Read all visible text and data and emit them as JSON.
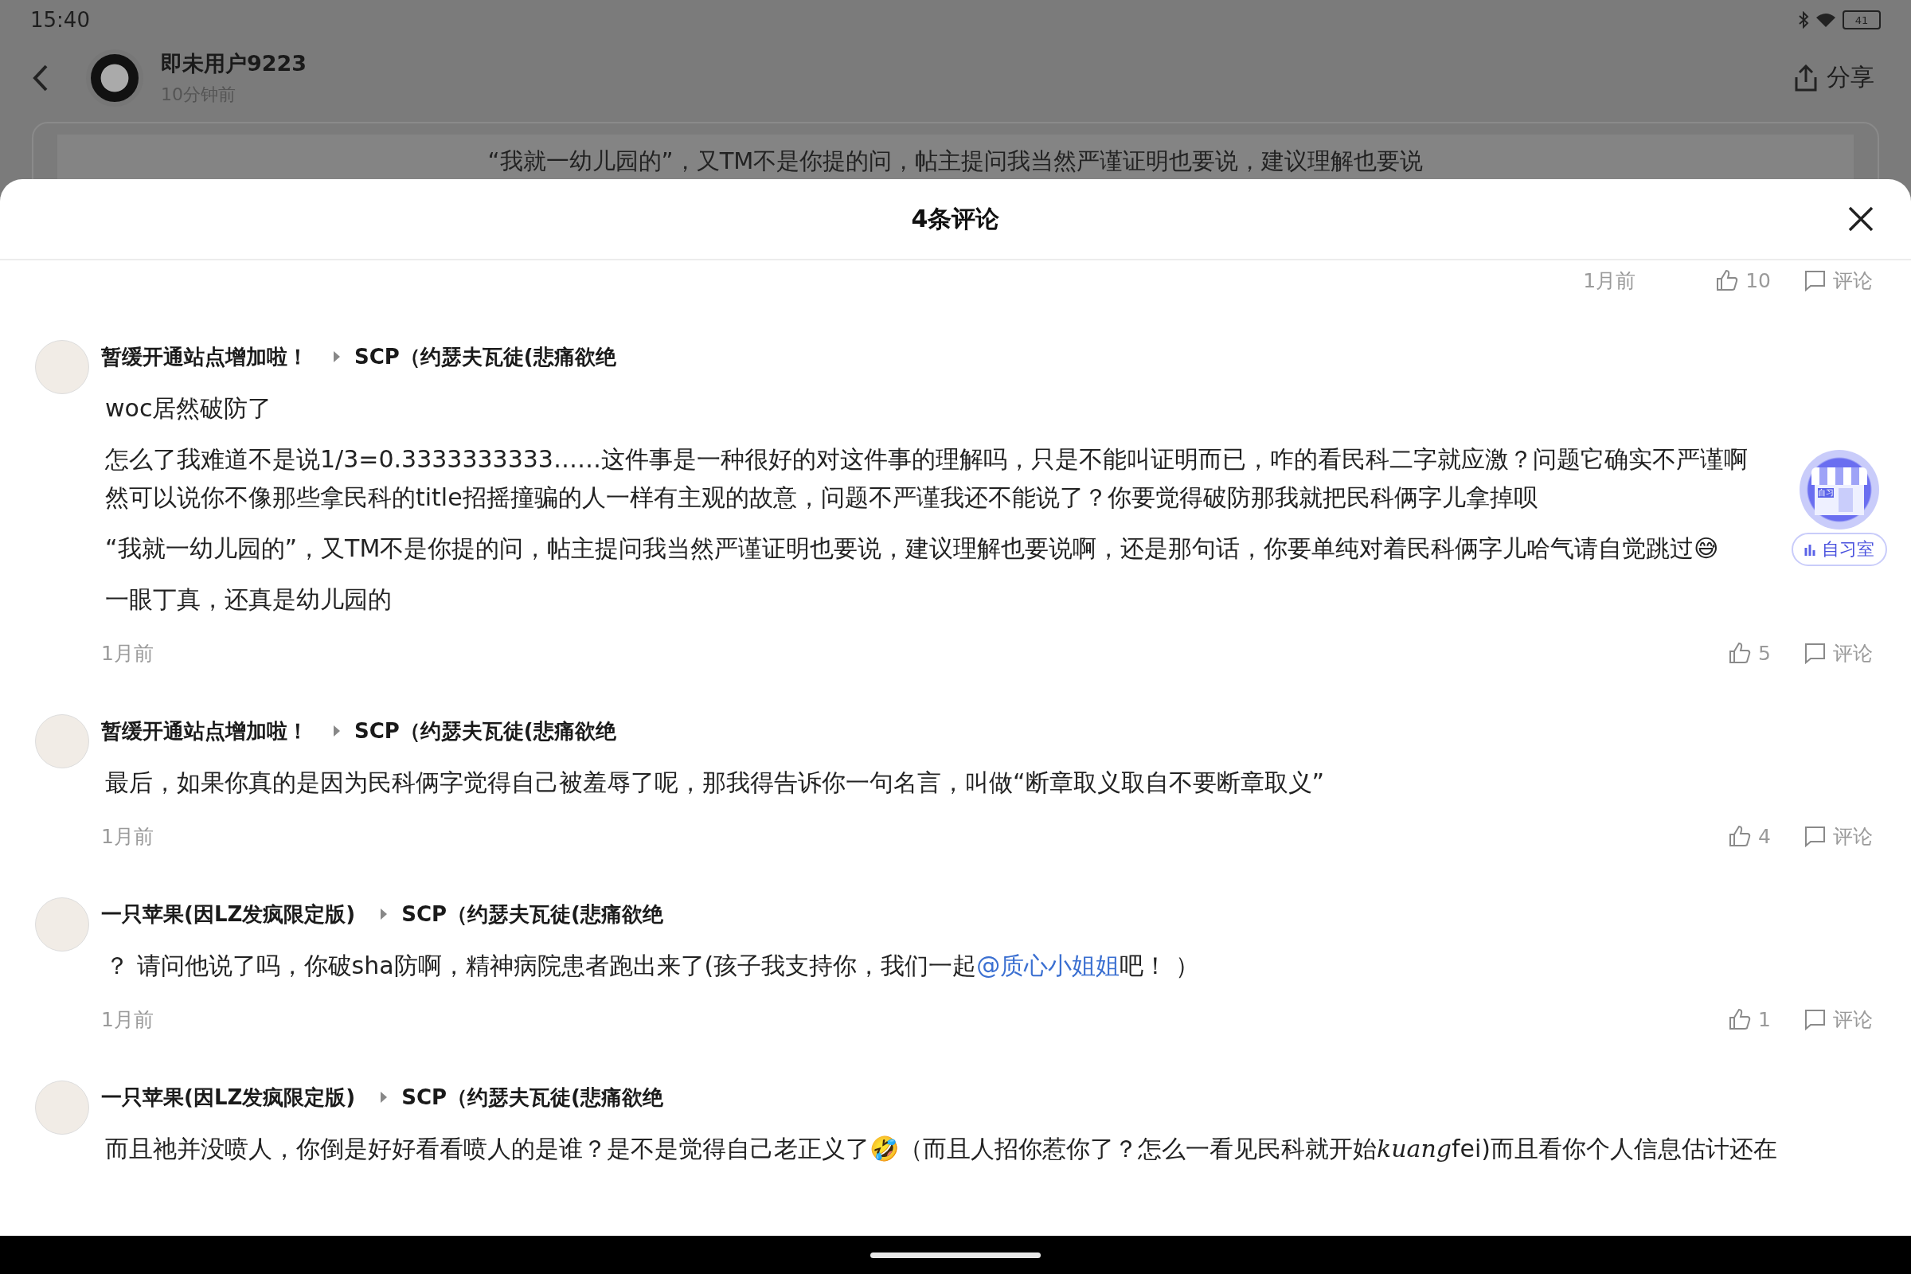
{
  "status_bar": {
    "time": "15:40",
    "battery": "41"
  },
  "post_header": {
    "user": "即未用户9223",
    "time": "10分钟前",
    "share": "分享",
    "excerpt": "“我就一幼儿园的”，又TM不是你提的问，帖主提问我当然严谨证明也要说，建议理解也要说"
  },
  "sheet": {
    "title": "4条评论"
  },
  "previous_meta": {
    "time": "1月前",
    "likes": "10",
    "reply": "评论"
  },
  "comments": [
    {
      "user": "暂缓开通站点增加啦！",
      "reply_to": "SCP（约瑟夫瓦徒(悲痛欲绝",
      "paragraphs": [
        {
          "lines": [
            "woc居然破防了"
          ]
        },
        {
          "lines": [
            "怎么了我难道不是说1/3=0.3333333333……这件事是一种很好的对这件事的理解吗，只是不能叫证明而已，咋的看民科二字就应激？问题它确实不严谨啊",
            "然可以说你不像那些拿民科的title招摇撞骗的人一样有主观的故意，问题不严谨我还不能说了？你要觉得破防那我就把民科俩字儿拿掉呗"
          ]
        },
        {
          "lines": [
            "“我就一幼儿园的”，又TM不是你提的问，帖主提问我当然严谨证明也要说，建议理解也要说啊，还是那句话，你要单纯对着民科俩字儿哈气请自觉跳过😅"
          ]
        },
        {
          "lines": [
            "一眼丁真，还真是幼儿园的"
          ]
        }
      ],
      "meta": {
        "time": "1月前",
        "likes": "5",
        "reply": "评论"
      }
    },
    {
      "user": "暂缓开通站点增加啦！",
      "reply_to": "SCP（约瑟夫瓦徒(悲痛欲绝",
      "paragraphs": [
        {
          "lines": [
            "最后，如果你真的是因为民科俩字觉得自己被羞辱了呢，那我得告诉你一句名言，叫做“断章取义取自不要断章取义”"
          ]
        }
      ],
      "meta": {
        "time": "1月前",
        "likes": "4",
        "reply": "评论"
      }
    },
    {
      "user": "一只苹果(因LZ发疯限定版)",
      "reply_to": "SCP（约瑟夫瓦徒(悲痛欲绝",
      "paragraphs": [
        {
          "segments": [
            {
              "kind": "text",
              "text": "？ 请问他说了吗，你破sha防啊，精神病院患者跑出来了(孩子我支持你，我们一起"
            },
            {
              "kind": "mention",
              "text": "@质心小姐姐"
            },
            {
              "kind": "text",
              "text": "吧！ ）"
            }
          ]
        }
      ],
      "meta": {
        "time": "1月前",
        "likes": "1",
        "reply": "评论"
      }
    },
    {
      "user": "一只苹果(因LZ发疯限定版)",
      "reply_to": "SCP（约瑟夫瓦徒(悲痛欲绝",
      "paragraphs": [
        {
          "segments": [
            {
              "kind": "text",
              "text": "而且祂并没喷人，你倒是好好看看喷人的是谁？是不是觉得自己老正义了🤣（而且人招你惹你了？怎么一看见民科就开始"
            },
            {
              "kind": "italic",
              "text": "kuang"
            },
            {
              "kind": "text",
              "text": "fei)而且看你个人信息估计还在"
            }
          ]
        }
      ]
    }
  ],
  "study_room": {
    "sign": "自习",
    "label": "自习室"
  }
}
